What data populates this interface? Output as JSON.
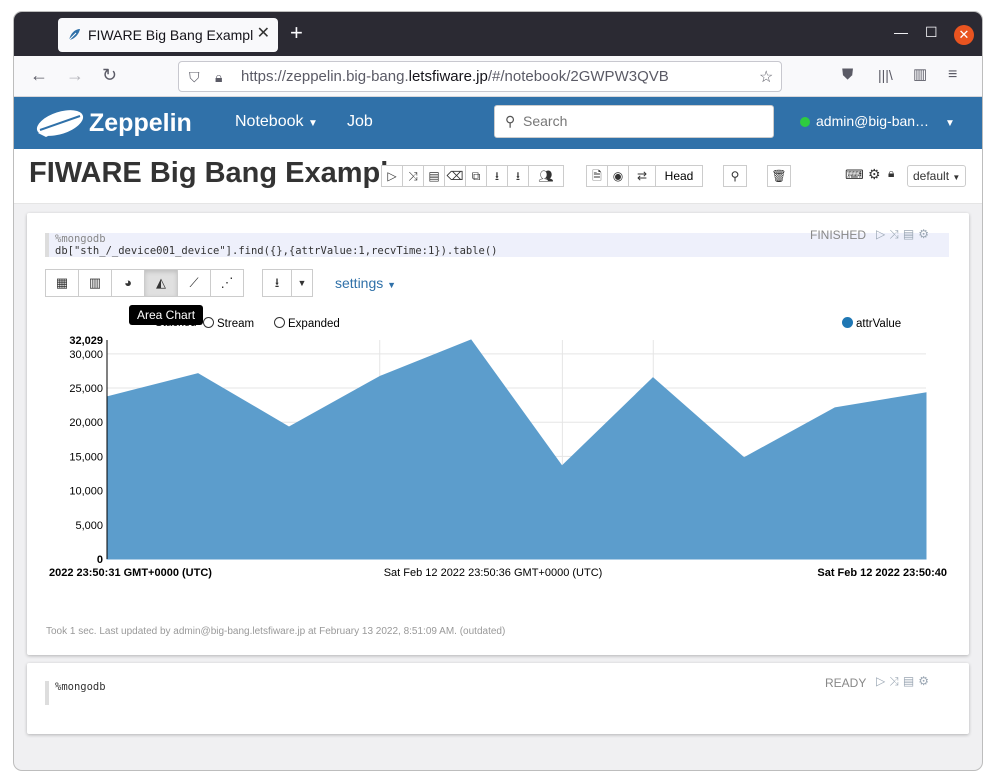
{
  "browser": {
    "tab_title": "FIWARE Big Bang Exampl",
    "url_prefix": "https://zeppelin.big-bang.",
    "url_host": "letsfiware.jp",
    "url_suffix": "/#/notebook/2GWPW3QVB"
  },
  "header": {
    "brand": "Zeppelin",
    "nav_notebook": "Notebook",
    "nav_job": "Job",
    "search_placeholder": "Search",
    "user": "admin@big-ban…"
  },
  "notebook": {
    "title": "FIWARE Big Bang Example",
    "head_label": "Head",
    "interpreter": "default"
  },
  "paragraph1": {
    "line1": "%mongodb",
    "line2": "db[\"sth_/_device001_device\"].find({},{attrValue:1,recvTime:1}).table()",
    "status": "FINISHED",
    "tooltip": "Area Chart",
    "settings": "settings",
    "radio_stacked": "Stacked",
    "radio_stream": "Stream",
    "radio_expanded": "Expanded",
    "footer": "Took 1 sec. Last updated by admin@big-bang.letsfiware.jp at February 13 2022, 8:51:09 AM. (outdated)"
  },
  "paragraph2": {
    "line1": "%mongodb",
    "status": "READY"
  },
  "chart_data": {
    "type": "area",
    "series": [
      {
        "name": "attrValue",
        "values": [
          23700,
          27100,
          19300,
          26700,
          32029,
          13600,
          26500,
          14800,
          22100,
          24300
        ]
      }
    ],
    "ylim": [
      0,
      32029
    ],
    "yticks": [
      "0",
      "5,000",
      "10,000",
      "15,000",
      "20,000",
      "25,000",
      "30,000"
    ],
    "ymax_label": "32,029",
    "xlabel_left": "2022 23:50:31 GMT+0000 (UTC)",
    "xlabel_mid": "Sat Feb 12 2022 23:50:36 GMT+0000 (UTC)",
    "xlabel_right": "Sat Feb 12 2022 23:50:40",
    "color": "#5c9dcc"
  }
}
